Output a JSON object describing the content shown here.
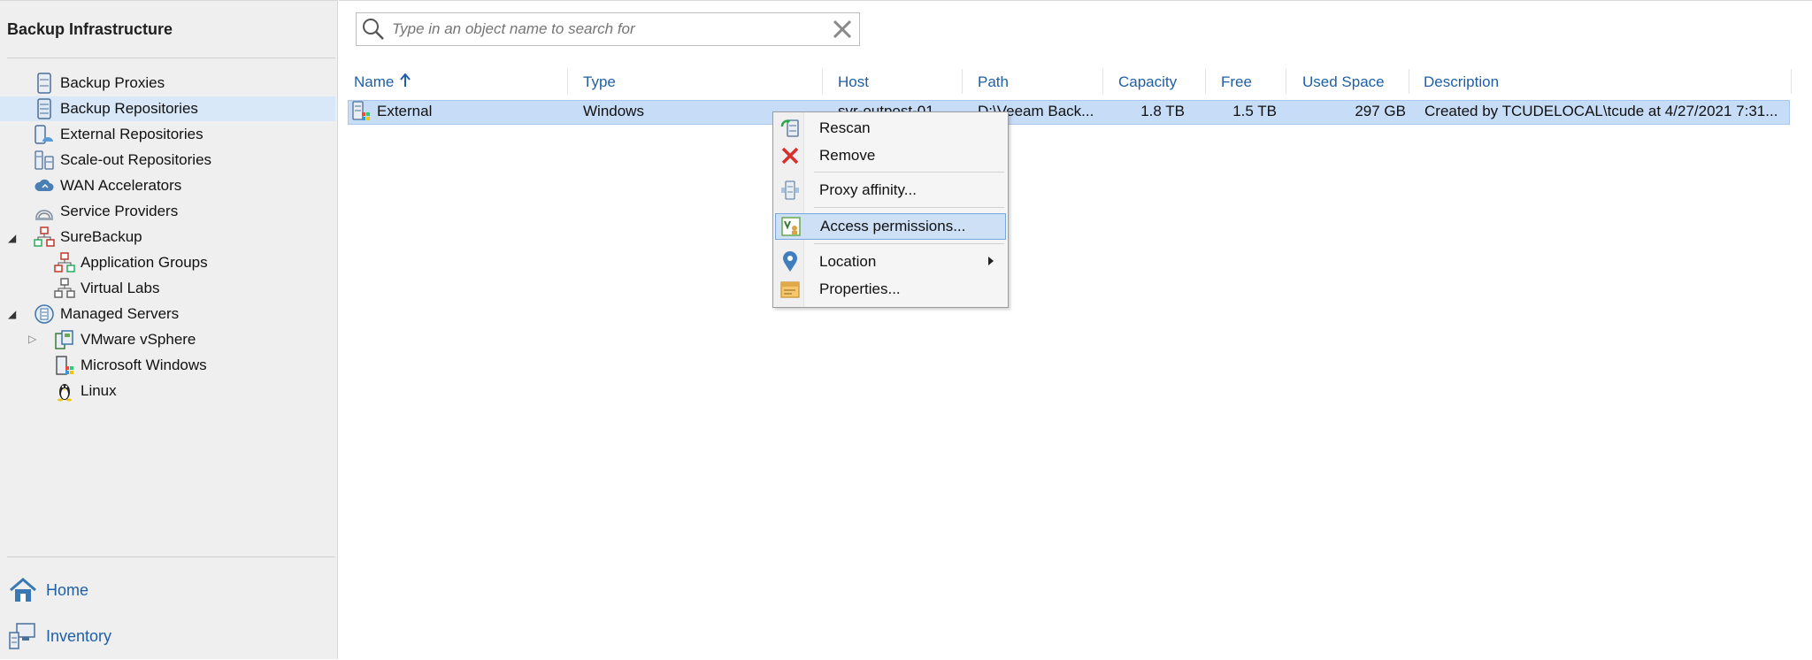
{
  "sidebar": {
    "title": "Backup Infrastructure",
    "items": [
      {
        "label": "Backup Proxies"
      },
      {
        "label": "Backup Repositories"
      },
      {
        "label": "External Repositories"
      },
      {
        "label": "Scale-out Repositories"
      },
      {
        "label": "WAN Accelerators"
      },
      {
        "label": "Service Providers"
      },
      {
        "label": "SureBackup"
      },
      {
        "label": "Application Groups"
      },
      {
        "label": "Virtual Labs"
      },
      {
        "label": "Managed Servers"
      },
      {
        "label": "VMware vSphere"
      },
      {
        "label": "Microsoft Windows"
      },
      {
        "label": "Linux"
      }
    ],
    "selected": "Backup Repositories",
    "nav": {
      "home": "Home",
      "inventory": "Inventory"
    }
  },
  "search": {
    "placeholder": "Type in an object name to search for"
  },
  "table": {
    "columns": [
      "Name",
      "Type",
      "Path",
      "Host",
      "Capacity",
      "Free",
      "Used Space",
      "Description"
    ],
    "sort": {
      "column": "Name",
      "direction": "ascending"
    },
    "rows": [
      {
        "name": "External",
        "type": "Windows",
        "host": "svr-outpost-01....",
        "path": "D:\\Veeam Back...",
        "capacity": "1.8 TB",
        "free": "1.5 TB",
        "used": "297 GB",
        "description": "Created by TCUDELOCAL\\tcude at 4/27/2021 7:31..."
      }
    ]
  },
  "context_menu": {
    "items": [
      {
        "label": "Rescan"
      },
      {
        "label": "Remove"
      },
      {
        "label": "Proxy affinity..."
      },
      {
        "label": "Access permissions...",
        "highlighted": true
      },
      {
        "label": "Location",
        "has_submenu": true
      },
      {
        "label": "Properties..."
      }
    ]
  },
  "colors": {
    "accent": "#1f5fa6",
    "selection": "#c7dcf6",
    "sidebar_bg": "#efefef"
  }
}
